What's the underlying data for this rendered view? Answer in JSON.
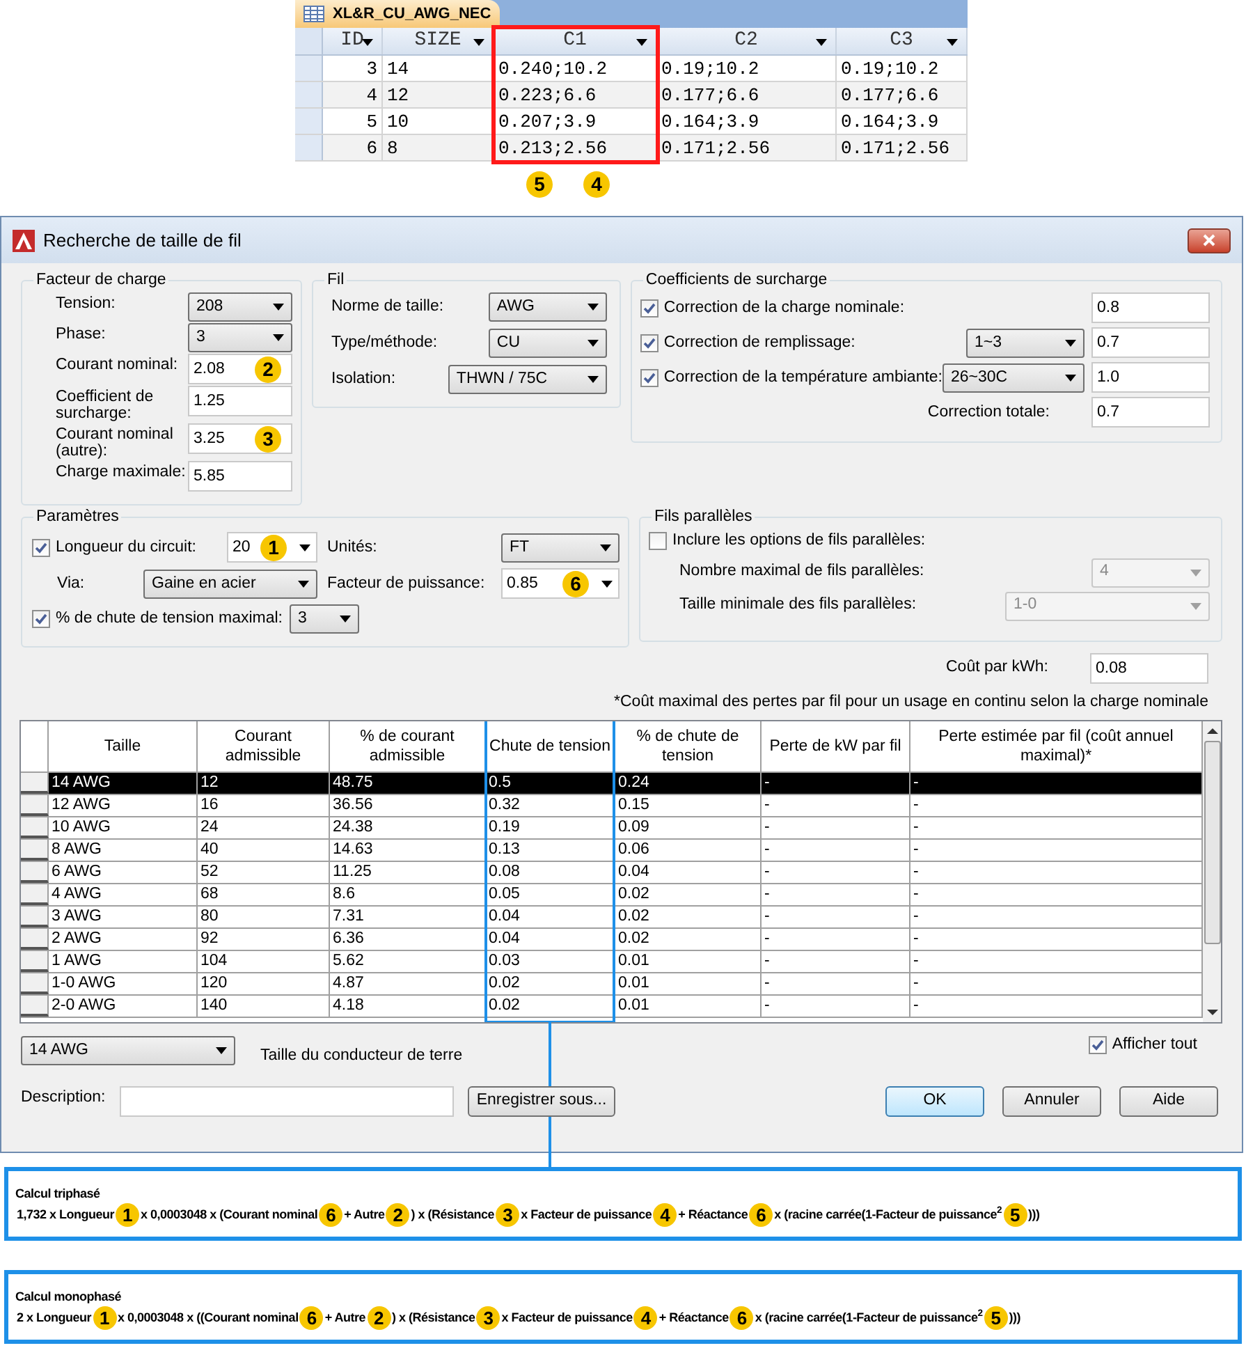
{
  "access_table": {
    "tab": "XL&R_CU_AWG_NEC",
    "columns": [
      "ID",
      "SIZE",
      "C1",
      "C2",
      "C3"
    ],
    "rows": [
      [
        "3",
        "14",
        "0.240;10.2",
        "0.19;10.2",
        "0.19;10.2"
      ],
      [
        "4",
        "12",
        "0.223;6.6",
        "0.177;6.6",
        "0.177;6.6"
      ],
      [
        "5",
        "10",
        "0.207;3.9",
        "0.164;3.9",
        "0.164;3.9"
      ],
      [
        "6",
        "8",
        "0.213;2.56",
        "0.171;2.56",
        "0.171;2.56"
      ]
    ],
    "callouts": [
      "5",
      "4"
    ]
  },
  "dialog": {
    "title": "Recherche de taille de fil",
    "load_factor": {
      "title": "Facteur de charge",
      "fields": [
        {
          "kind": "select",
          "label": "Tension:",
          "value": "208"
        },
        {
          "kind": "select",
          "label": "Phase:",
          "value": "3"
        },
        {
          "kind": "input",
          "label": "Courant nominal:",
          "value": "2.08",
          "badge": "2"
        },
        {
          "kind": "input",
          "label": "Coefficient de surcharge:",
          "value": "1.25"
        },
        {
          "kind": "input",
          "label": "Courant nominal (autre):",
          "value": "3.25",
          "badge": "3"
        },
        {
          "kind": "input",
          "label": "Charge maximale:",
          "value": "5.85"
        }
      ]
    },
    "wire": {
      "title": "Fil",
      "fields": [
        {
          "label": "Norme de taille:",
          "value": "AWG"
        },
        {
          "label": "Type/méthode:",
          "value": "CU"
        },
        {
          "label": "Isolation:",
          "value": "THWN / 75C"
        }
      ]
    },
    "overload": {
      "title": "Coefficients de surcharge",
      "rows": [
        {
          "label": "Correction de la charge nominale:",
          "checked": true,
          "value": "0.8"
        },
        {
          "label": "Correction de remplissage:",
          "checked": true,
          "select": "1~3",
          "value": "0.7"
        },
        {
          "label": "Correction de la température ambiante:",
          "checked": true,
          "select": "26~30C",
          "value": "1.0"
        }
      ],
      "total": {
        "label": "Correction totale:",
        "value": "0.7"
      }
    },
    "parameters": {
      "title": "Paramètres",
      "circuit_length": {
        "label": "Longueur du circuit:",
        "checked": true,
        "value": "20",
        "badge": "1"
      },
      "units": {
        "label": "Unités:",
        "value": "FT"
      },
      "via": {
        "label": "Via:",
        "value": "Gaine en acier"
      },
      "power_factor": {
        "label": "Facteur de puissance:",
        "value": "0.85",
        "badge": "6"
      },
      "max_drop": {
        "label": "% de chute de tension maximal:",
        "checked": true,
        "value": "3"
      }
    },
    "parallel": {
      "title": "Fils parallèles",
      "include": {
        "label": "Inclure les options de fils parallèles:",
        "checked": false
      },
      "fields": [
        {
          "label": "Nombre maximal de fils parallèles:",
          "value": "4",
          "disabled": true
        },
        {
          "label": "Taille minimale des fils parallèles:",
          "value": "1-0",
          "disabled": true
        }
      ]
    },
    "cost": {
      "label": "Coût par kWh:",
      "value": "0.08"
    },
    "footnote": "*Coût maximal des pertes par fil pour un usage en continu selon la charge nominale",
    "grid": {
      "columns": [
        "Taille",
        "Courant admissible",
        "% de courant admissible",
        "Chute de tension",
        "% de chute de tension",
        "Perte de kW par fil",
        "Perte estimée par fil (coût annuel maximal)*"
      ],
      "rows": [
        {
          "selected": true,
          "cells": [
            "14 AWG",
            "12",
            "48.75",
            "0.5",
            "0.24",
            "-",
            "-"
          ]
        },
        {
          "selected": false,
          "cells": [
            "12 AWG",
            "16",
            "36.56",
            "0.32",
            "0.15",
            "-",
            "-"
          ]
        },
        {
          "selected": false,
          "cells": [
            "10 AWG",
            "24",
            "24.38",
            "0.19",
            "0.09",
            "-",
            "-"
          ]
        },
        {
          "selected": false,
          "cells": [
            "8 AWG",
            "40",
            "14.63",
            "0.13",
            "0.06",
            "-",
            "-"
          ]
        },
        {
          "selected": false,
          "cells": [
            "6 AWG",
            "52",
            "11.25",
            "0.08",
            "0.04",
            "-",
            "-"
          ]
        },
        {
          "selected": false,
          "cells": [
            "4 AWG",
            "68",
            "8.6",
            "0.05",
            "0.02",
            "-",
            "-"
          ]
        },
        {
          "selected": false,
          "cells": [
            "3 AWG",
            "80",
            "7.31",
            "0.04",
            "0.02",
            "-",
            "-"
          ]
        },
        {
          "selected": false,
          "cells": [
            "2 AWG",
            "92",
            "6.36",
            "0.04",
            "0.02",
            "-",
            "-"
          ]
        },
        {
          "selected": false,
          "cells": [
            "1 AWG",
            "104",
            "5.62",
            "0.03",
            "0.01",
            "-",
            "-"
          ]
        },
        {
          "selected": false,
          "cells": [
            "1-0 AWG",
            "120",
            "4.87",
            "0.02",
            "0.01",
            "-",
            "-"
          ]
        },
        {
          "selected": false,
          "cells": [
            "2-0 AWG",
            "140",
            "4.18",
            "0.02",
            "0.01",
            "-",
            "-"
          ]
        }
      ]
    },
    "ground": {
      "value": "14 AWG",
      "label": "Taille du conducteur de terre"
    },
    "show_all": {
      "label": "Afficher tout",
      "checked": true
    },
    "description": {
      "label": "Description:"
    },
    "save_as": "Enregistrer sous...",
    "buttons": [
      {
        "label": "OK",
        "default": true
      },
      {
        "label": "Annuler",
        "default": false
      },
      {
        "label": "Aide",
        "default": false
      }
    ]
  },
  "formulas": [
    {
      "title": "Calcul triphasé",
      "parts": [
        {
          "kind": "text",
          "text": "1,732 x Longueur"
        },
        {
          "kind": "badge",
          "text": "1"
        },
        {
          "kind": "text",
          "text": "x 0,0003048 x (Courant nominal"
        },
        {
          "kind": "badge",
          "text": "6"
        },
        {
          "kind": "text",
          "text": "+ Autre"
        },
        {
          "kind": "badge",
          "text": "2"
        },
        {
          "kind": "text",
          "text": ") x (Résistance"
        },
        {
          "kind": "badge",
          "text": "3"
        },
        {
          "kind": "text",
          "text": "x Facteur de puissance"
        },
        {
          "kind": "badge",
          "text": "4"
        },
        {
          "kind": "text",
          "text": "+ Réactance"
        },
        {
          "kind": "badge",
          "text": "6"
        },
        {
          "kind": "text",
          "text": "x (racine carrée(1-Facteur de puissance$^{2}$"
        },
        {
          "kind": "badge",
          "text": "5"
        },
        {
          "kind": "text",
          "text": ")))"
        }
      ]
    },
    {
      "title": "Calcul monophasé",
      "parts": [
        {
          "kind": "text",
          "text": "2 x Longueur"
        },
        {
          "kind": "badge",
          "text": "1"
        },
        {
          "kind": "text",
          "text": "x 0,0003048 x ((Courant nominal"
        },
        {
          "kind": "badge",
          "text": "6"
        },
        {
          "kind": "text",
          "text": "+ Autre"
        },
        {
          "kind": "badge",
          "text": "2"
        },
        {
          "kind": "text",
          "text": ") x (Résistance"
        },
        {
          "kind": "badge",
          "text": "3"
        },
        {
          "kind": "text",
          "text": "x Facteur de puissance"
        },
        {
          "kind": "badge",
          "text": "4"
        },
        {
          "kind": "text",
          "text": "+ Réactance"
        },
        {
          "kind": "badge",
          "text": "6"
        },
        {
          "kind": "text",
          "text": "x (racine carrée(1-Facteur de puissance$^{2}$"
        },
        {
          "kind": "badge",
          "text": "5"
        },
        {
          "kind": "text",
          "text": ")))"
        }
      ]
    }
  ]
}
